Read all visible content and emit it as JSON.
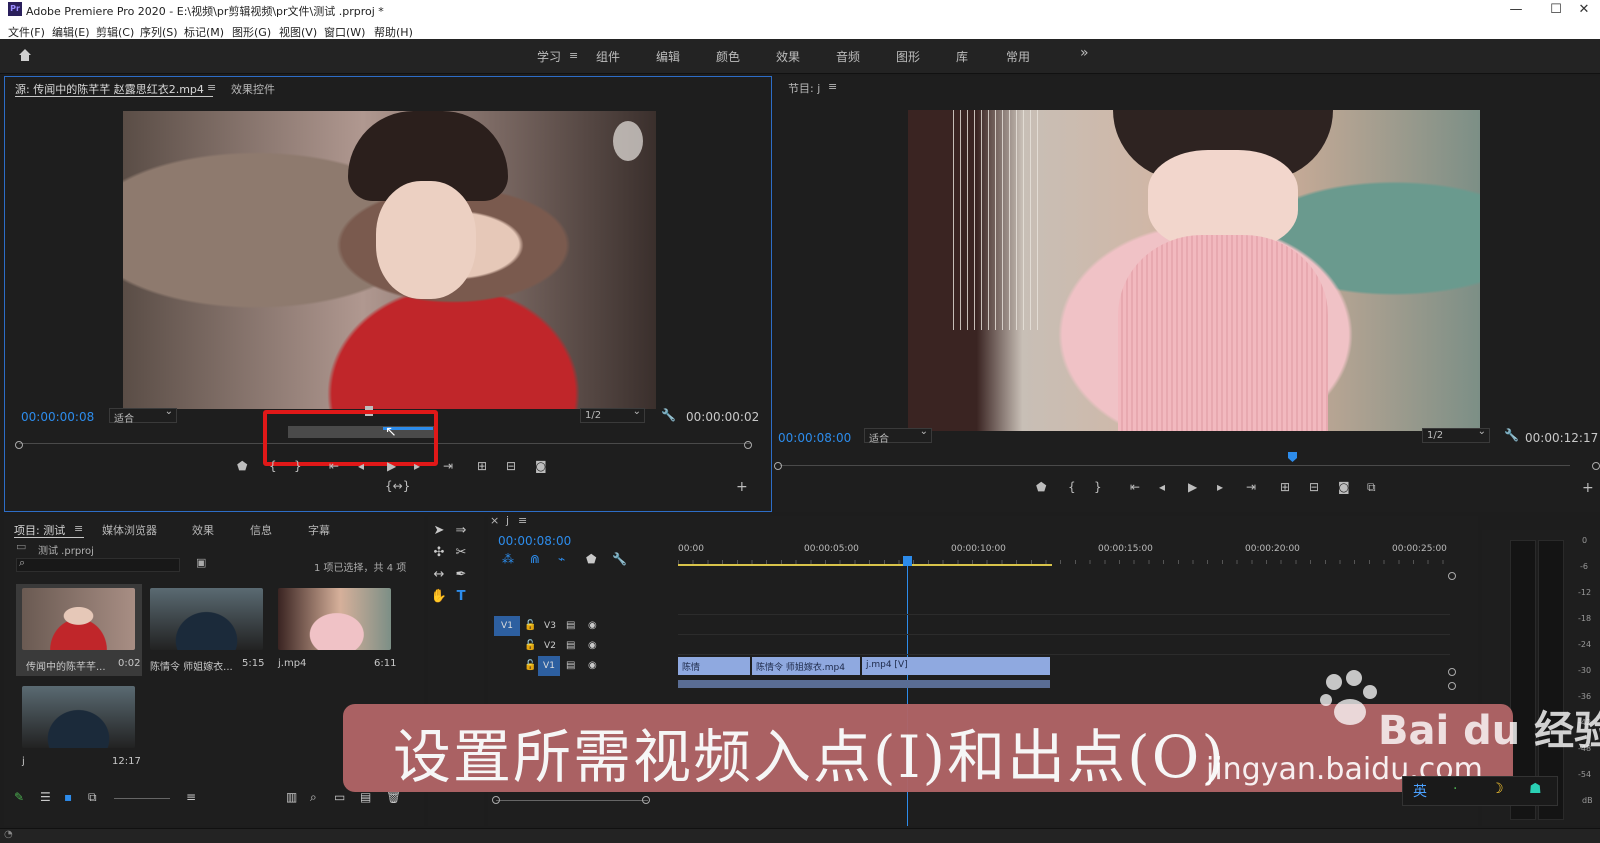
{
  "window": {
    "title": "Adobe Premiere Pro 2020 - E:\\视频\\pr剪辑视频\\pr文件\\测试 .prproj *",
    "app_icon": "Pr",
    "minimize": "—",
    "maximize": "☐",
    "close": "✕"
  },
  "menu": [
    "文件(F)",
    "编辑(E)",
    "剪辑(C)",
    "序列(S)",
    "标记(M)",
    "图形(G)",
    "视图(V)",
    "窗口(W)",
    "帮助(H)"
  ],
  "workspaces": {
    "active": "学习",
    "items": [
      "组件",
      "编辑",
      "颜色",
      "效果",
      "音频",
      "图形",
      "库",
      "常用"
    ],
    "more": "»"
  },
  "source_monitor": {
    "tab_source": "源: 传闻中的陈芊芊 赵露思红衣2.mp4",
    "tab_effects": "效果控件",
    "timecode": "00:00:00:08",
    "fit": "适合",
    "resolution": "1/2",
    "duration": "00:00:00:02"
  },
  "program_monitor": {
    "tab": "节目: j",
    "timecode": "00:00:08:00",
    "fit": "适合",
    "resolution": "1/2",
    "duration": "00:00:12:17"
  },
  "project_panel": {
    "tabs": [
      "项目: 测试",
      "媒体浏览器",
      "效果",
      "信息",
      "字幕"
    ],
    "file": "测试 .prproj",
    "selection_info": "1 项已选择，共 4 项",
    "items": [
      {
        "name": "传闻中的陈芊芊...",
        "duration": "0:02"
      },
      {
        "name": "陈情令 师姐嫁衣...",
        "duration": "5:15"
      },
      {
        "name": "j.mp4",
        "duration": "6:11"
      },
      {
        "name": "j",
        "duration": "12:17"
      }
    ]
  },
  "timeline": {
    "tab": "j",
    "timecode": "00:00:08:00",
    "ruler": [
      "00:00",
      "00:00:05:00",
      "00:00:10:00",
      "00:00:15:00",
      "00:00:20:00",
      "00:00:25:00"
    ],
    "tracks": [
      "V3",
      "V2",
      "V1"
    ],
    "src_patch": "V1",
    "clips": [
      "陈情",
      "陈情令 师姐嫁衣.mp4",
      "j.mp4 [V]"
    ]
  },
  "meter_scale": [
    "0",
    "-6",
    "-12",
    "-18",
    "-24",
    "-30",
    "-36",
    "-42",
    "-48",
    "-54",
    "dB"
  ],
  "overlay": {
    "caption": "设置所需视频入点(I)和出点(O)",
    "watermark_brand": "Bai du 经验",
    "watermark_url": "jingyan.baidu.com",
    "tray": [
      "英",
      "·",
      "☽",
      "☗"
    ]
  },
  "colors": {
    "accent_blue": "#2d8ceb",
    "highlight_red": "#e01818",
    "clip_blue": "#8fa9e0",
    "caption_bg": "#b06466"
  }
}
